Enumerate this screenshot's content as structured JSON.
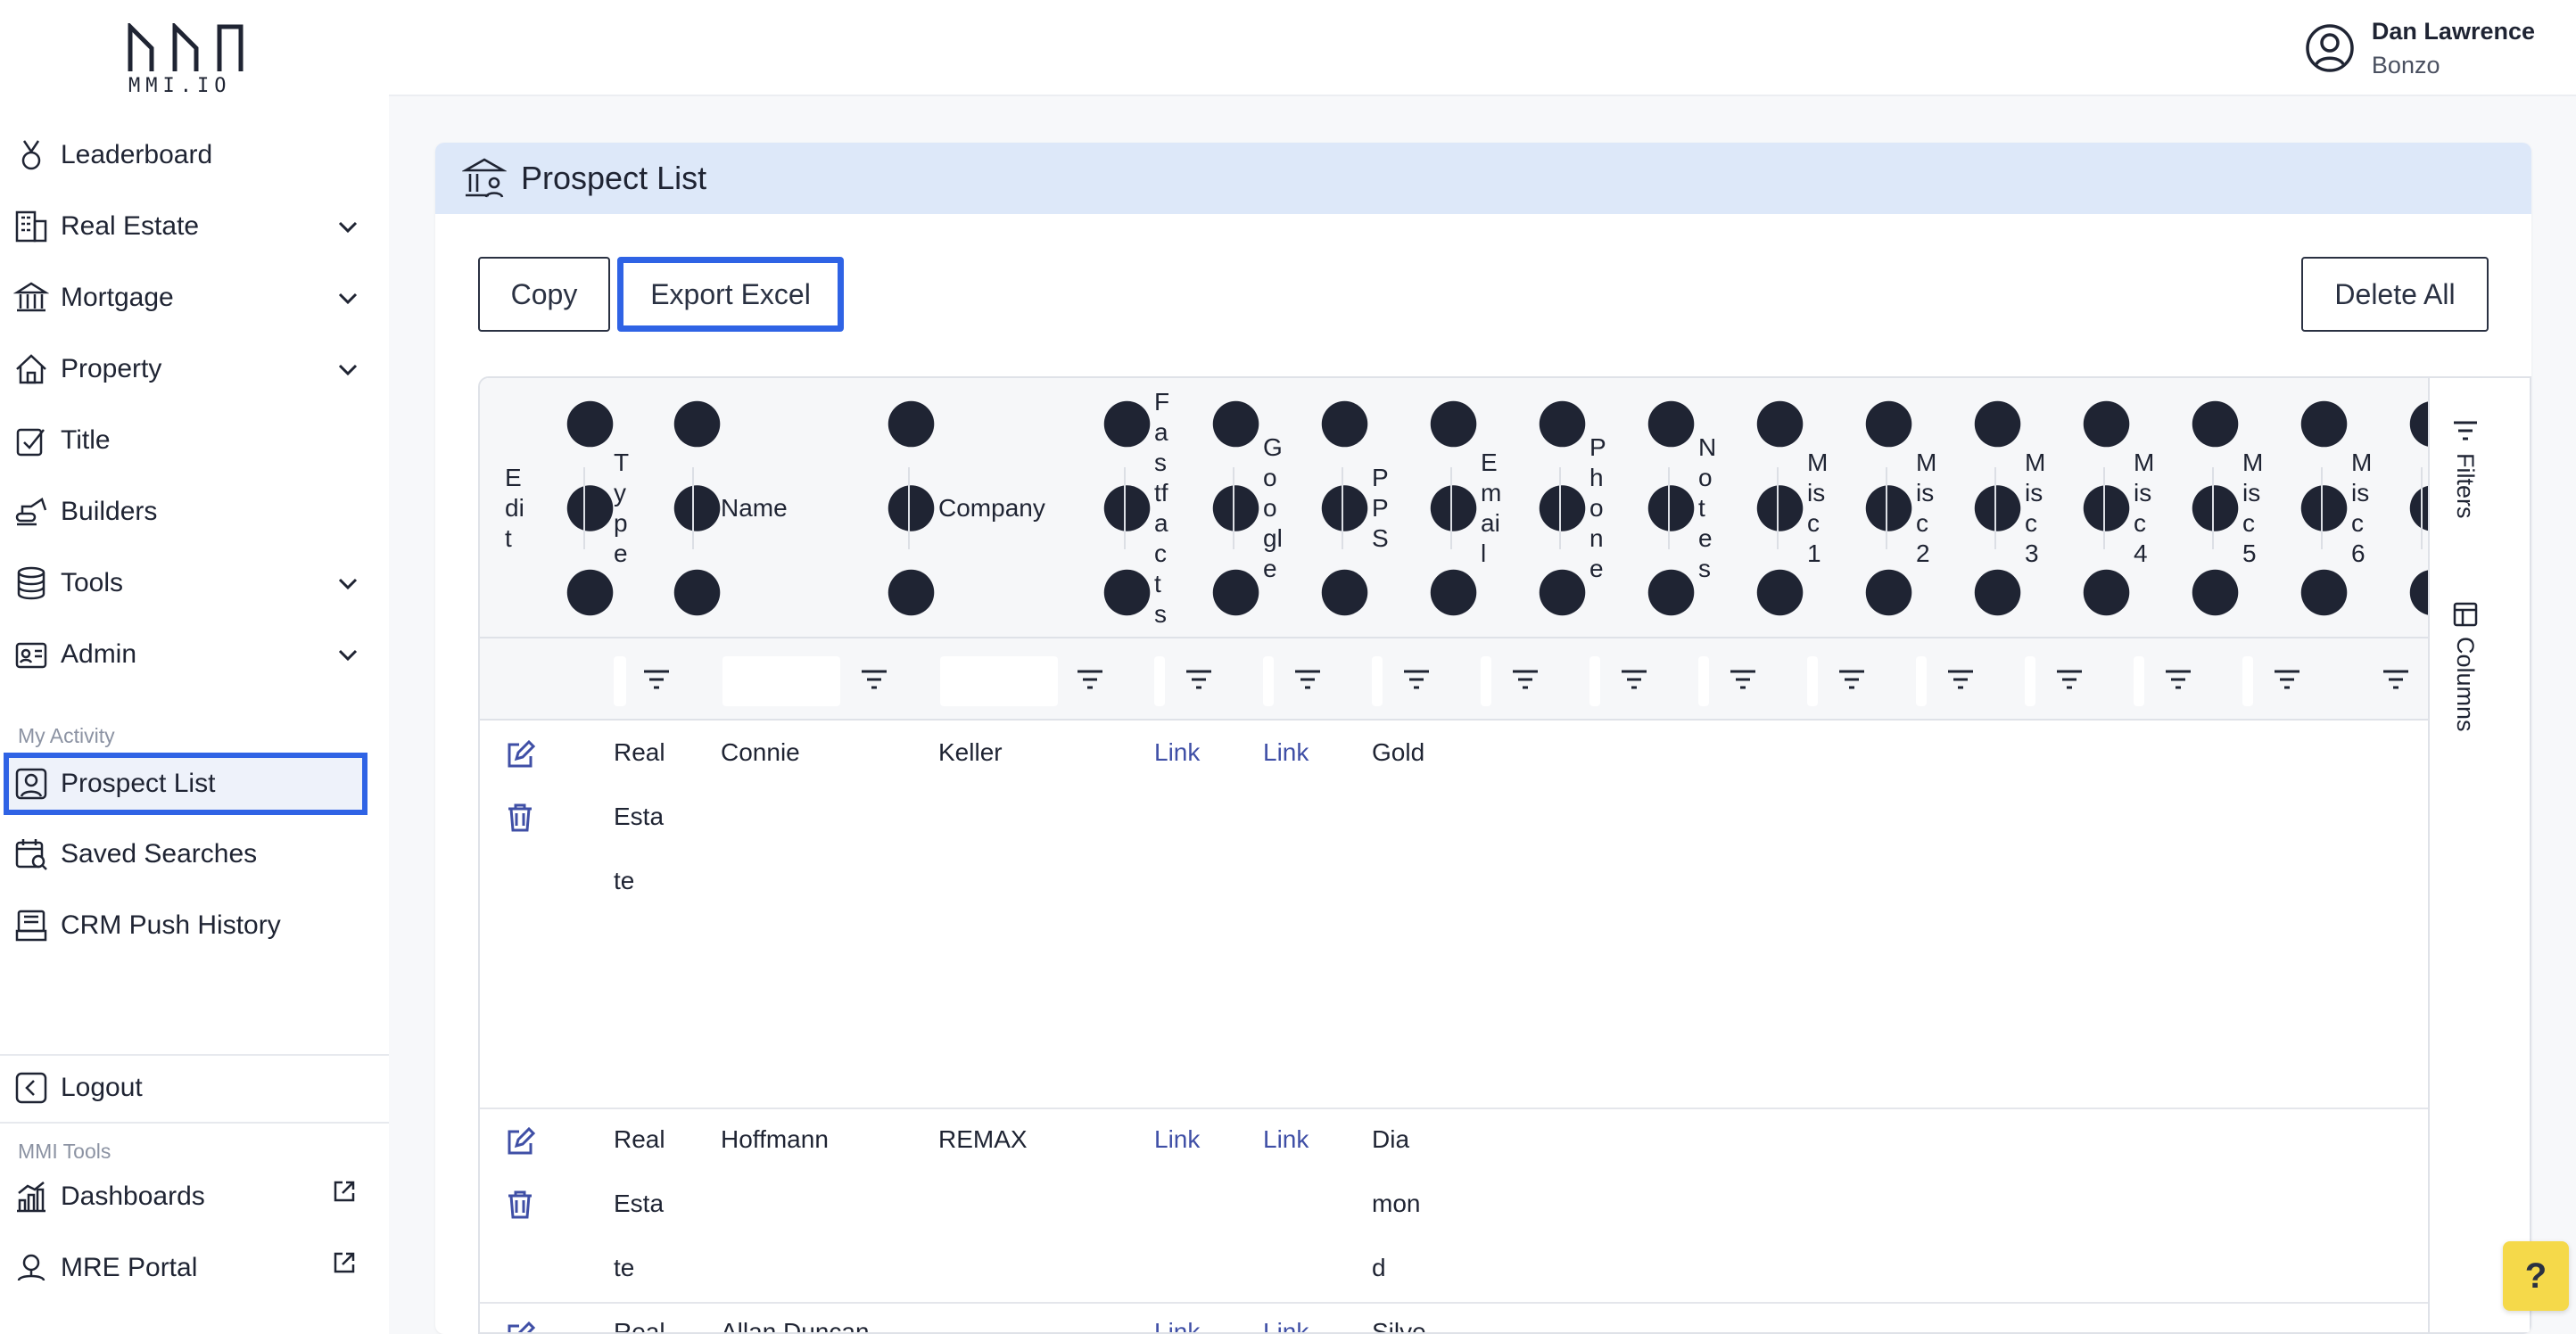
{
  "app": {
    "logo_text": "MMI.IO"
  },
  "user": {
    "name": "Dan Lawrence",
    "org": "Bonzo"
  },
  "sidebar": {
    "items": [
      {
        "label": "Leaderboard"
      },
      {
        "label": "Real Estate"
      },
      {
        "label": "Mortgage"
      },
      {
        "label": "Property"
      },
      {
        "label": "Title"
      },
      {
        "label": "Builders"
      },
      {
        "label": "Tools"
      },
      {
        "label": "Admin"
      }
    ],
    "activity_label": "My Activity",
    "activity_items": [
      {
        "label": "Prospect List"
      },
      {
        "label": "Saved Searches"
      },
      {
        "label": "CRM Push History"
      }
    ],
    "logout_label": "Logout",
    "tools_label": "MMI Tools",
    "tool_items": [
      {
        "label": "Dashboards"
      },
      {
        "label": "MRE Portal"
      }
    ]
  },
  "page": {
    "title": "Prospect List",
    "copy_label": "Copy",
    "export_label": "Export Excel",
    "delete_all_label": "Delete All"
  },
  "grid": {
    "columns": [
      {
        "label": "Edit"
      },
      {
        "label": "Type"
      },
      {
        "label": "Name"
      },
      {
        "label": "Company"
      },
      {
        "label": "Fastfacts"
      },
      {
        "label": "Google"
      },
      {
        "label": "PPS"
      },
      {
        "label": "Email"
      },
      {
        "label": "Phone"
      },
      {
        "label": "Notes"
      },
      {
        "label": "Misc1"
      },
      {
        "label": "Misc2"
      },
      {
        "label": "Misc3"
      },
      {
        "label": "Misc4"
      },
      {
        "label": "Misc5"
      },
      {
        "label": "Misc6"
      }
    ],
    "side_tabs": {
      "filters": "Filters",
      "columns": "Columns"
    },
    "rows": [
      {
        "type": "Real Estate",
        "name": "Connie",
        "company": "Keller",
        "fastfacts": "Link",
        "google": "Link",
        "pps": "Gold"
      },
      {
        "type": "Real Estate",
        "name": "Hoffmann",
        "company": "REMAX",
        "fastfacts": "Link",
        "google": "Link",
        "pps": "Diamond"
      },
      {
        "type": "Real",
        "name": "Allan Duncan",
        "company": "",
        "fastfacts": "Link",
        "google": "Link",
        "pps": "Silve"
      }
    ]
  },
  "help": {
    "label": "?"
  },
  "colors": {
    "accent": "#2f63e5",
    "header_band": "#dde8f9",
    "link": "#3f4fa6",
    "help": "#f5d94a"
  }
}
